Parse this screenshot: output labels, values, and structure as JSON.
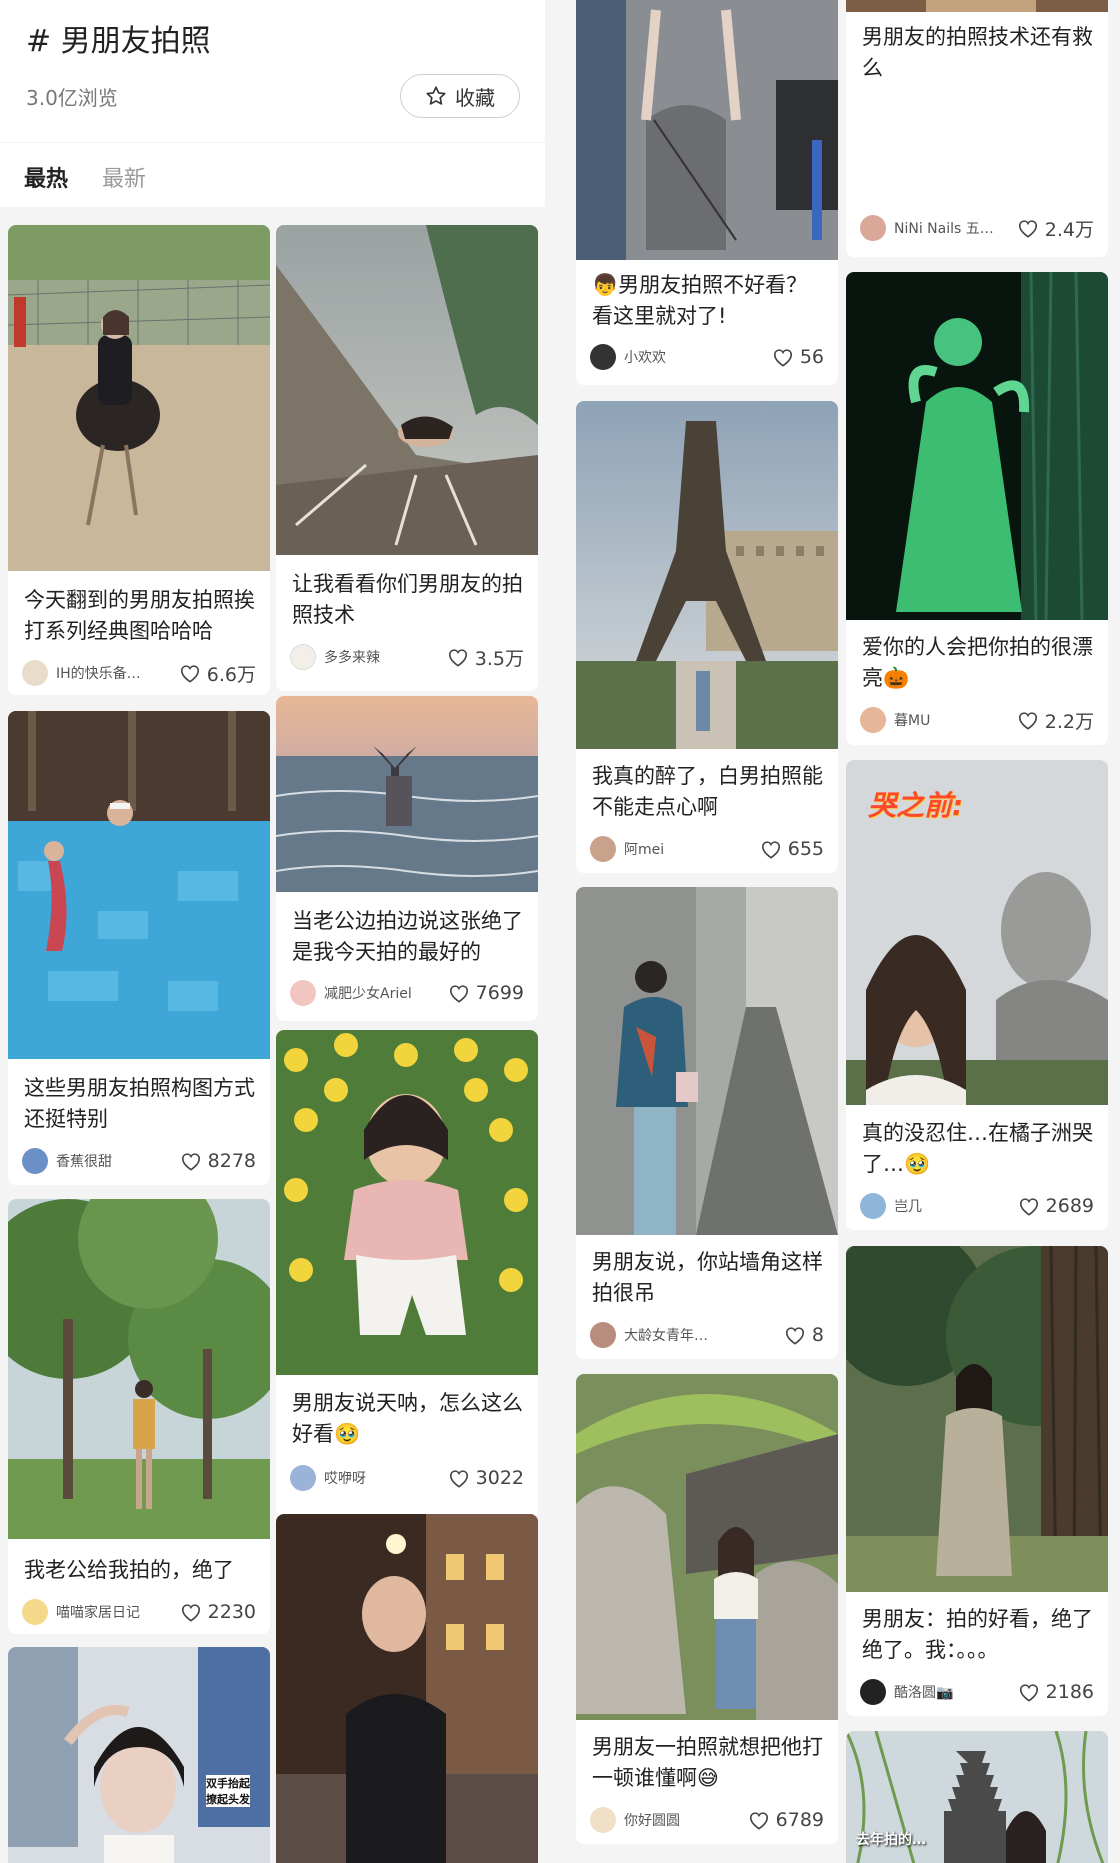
{
  "header": {
    "topic": "# 男朋友拍照",
    "views": "3.0亿浏览",
    "favorite_label": "收藏"
  },
  "tabs": [
    {
      "label": "最热",
      "active": true
    },
    {
      "label": "最新",
      "active": false
    }
  ],
  "cards": [
    {
      "title": "今天翻到的男朋友拍照挨打系列经典图哈哈哈",
      "author": "IH的快乐备…",
      "likes": "6.6万",
      "image": "ostrich-riding-photo"
    },
    {
      "title": "让我看看你们男朋友的拍照技术",
      "author": "多多来辣",
      "likes": "3.5万",
      "image": "great-wall-photo"
    },
    {
      "title": "这些男朋友拍照构图方式还挺特别",
      "author": "香蕉很甜",
      "likes": "8278",
      "image": "swimming-pool-photo"
    },
    {
      "title": "当老公边拍边说这张绝了是我今天拍的最好的",
      "author": "减肥少女Ariel",
      "likes": "7699",
      "image": "beach-sunset-photo"
    },
    {
      "title": "我老公给我拍的，绝了",
      "author": "喵喵家居日记",
      "likes": "2230",
      "image": "park-trees-photo"
    },
    {
      "title": "男朋友说天呐，怎么这么好看🥹",
      "author": "哎咿呀",
      "likes": "3022",
      "image": "tulip-garden-photo"
    },
    {
      "title": "",
      "author": "",
      "likes": "",
      "image": "street-selfie-photo",
      "overlay_tags": [
        "双手抬起",
        "撩起头发"
      ]
    },
    {
      "title": "",
      "author": "",
      "likes": "",
      "image": "night-street-photo"
    },
    {
      "title": "👦男朋友拍照不好看？看这里就对了!",
      "author": "小欢欢",
      "likes": "56",
      "image": "street-pose-photo"
    },
    {
      "title": "男朋友的拍照技术还有救么",
      "author": "NiNi Nails 五…",
      "likes": "2.4万",
      "image": "top-crop-photo"
    },
    {
      "title": "我真的醉了，白男拍照能不能走点心啊",
      "author": "阿mei",
      "likes": "655",
      "image": "eiffel-tower-photo"
    },
    {
      "title": "爱你的人会把你拍的很漂亮🎃",
      "author": "暮MU",
      "likes": "2.2万",
      "image": "green-forest-photo"
    },
    {
      "title": "男朋友说，你站墙角这样拍很吊",
      "author": "大龄女青年…",
      "likes": "8",
      "image": "alley-photo"
    },
    {
      "title": "真的没忍住…在橘子洲哭了…🥹",
      "author": "岂几",
      "likes": "2689",
      "image": "statue-selfie-photo",
      "overlay_caption": "哭之前:"
    },
    {
      "title": "男朋友一拍照就想把他打一顿谁懂啊😅",
      "author": "你好圆圆",
      "likes": "6789",
      "image": "garden-rocks-photo"
    },
    {
      "title": "男朋友：拍的好看，绝了绝了。我：。。。",
      "author": "酷洛圆📷",
      "likes": "2186",
      "image": "tree-trunk-photo"
    },
    {
      "title": "",
      "author": "",
      "likes": "",
      "image": "pagoda-photo",
      "overlay_caption": "去年拍的…"
    }
  ]
}
